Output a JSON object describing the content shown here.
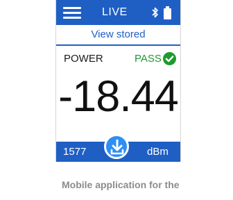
{
  "header": {
    "mode_label": "LIVE",
    "icons": [
      "menu-icon",
      "bluetooth-icon",
      "battery-icon"
    ]
  },
  "subheader": {
    "view_stored_label": "View stored"
  },
  "measurement": {
    "type_label": "POWER",
    "status_label": "PASS",
    "status_icon": "check-circle-icon",
    "status_color": "#1f9a2e",
    "value": "-18.44"
  },
  "footer": {
    "count": "1577",
    "unit": "dBm",
    "action_icon": "download-icon"
  },
  "caption": "Mobile application for the",
  "colors": {
    "accent": "#1f5fc4",
    "button": "#2f8ef3"
  }
}
